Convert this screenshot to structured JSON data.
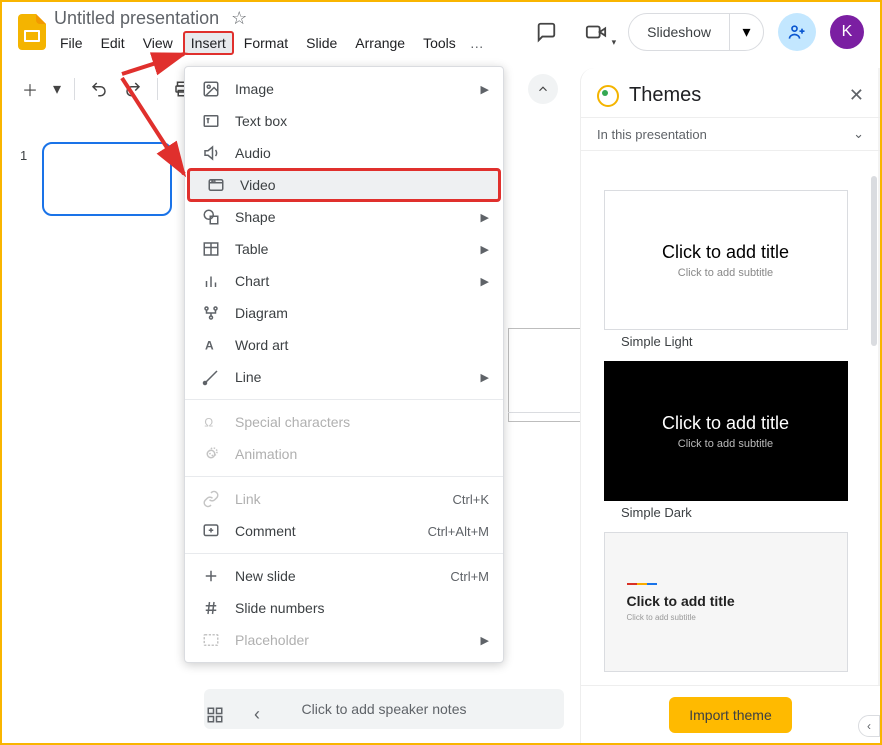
{
  "doc": {
    "title": "Untitled presentation"
  },
  "menubar": {
    "items": [
      "File",
      "Edit",
      "View",
      "Insert",
      "Format",
      "Slide",
      "Arrange",
      "Tools"
    ],
    "active_index": 3,
    "more": "…"
  },
  "header": {
    "slideshow": "Slideshow",
    "avatar_letter": "K"
  },
  "filmstrip": {
    "slide_number": "1"
  },
  "insert_menu": {
    "items": [
      {
        "label": "Image",
        "icon": "image-icon",
        "submenu": true
      },
      {
        "label": "Text box",
        "icon": "textbox-icon"
      },
      {
        "label": "Audio",
        "icon": "audio-icon"
      },
      {
        "label": "Video",
        "icon": "video-icon",
        "highlight": true,
        "boxed": true
      },
      {
        "label": "Shape",
        "icon": "shape-icon",
        "submenu": true
      },
      {
        "label": "Table",
        "icon": "table-icon",
        "submenu": true
      },
      {
        "label": "Chart",
        "icon": "chart-icon",
        "submenu": true
      },
      {
        "label": "Diagram",
        "icon": "diagram-icon"
      },
      {
        "label": "Word art",
        "icon": "wordart-icon"
      },
      {
        "label": "Line",
        "icon": "line-icon",
        "submenu": true
      }
    ],
    "items2": [
      {
        "label": "Special characters",
        "icon": "omega-icon",
        "disabled": true
      },
      {
        "label": "Animation",
        "icon": "animation-icon",
        "disabled": true
      }
    ],
    "items3": [
      {
        "label": "Link",
        "icon": "link-icon",
        "disabled": true,
        "shortcut": "Ctrl+K"
      },
      {
        "label": "Comment",
        "icon": "comment-add-icon",
        "shortcut": "Ctrl+Alt+M"
      }
    ],
    "items4": [
      {
        "label": "New slide",
        "icon": "plus-icon",
        "shortcut": "Ctrl+M"
      },
      {
        "label": "Slide numbers",
        "icon": "hash-icon"
      },
      {
        "label": "Placeholder",
        "icon": "placeholder-icon",
        "disabled": true,
        "submenu": true
      }
    ]
  },
  "themes": {
    "title": "Themes",
    "subtitle": "In this presentation",
    "cards": [
      {
        "name": "Simple Light",
        "title": "Click to add title",
        "sub": "Click to add subtitle",
        "variant": "light"
      },
      {
        "name": "Simple Dark",
        "title": "Click to add title",
        "sub": "Click to add subtitle",
        "variant": "dark"
      },
      {
        "name": "",
        "title": "Click to add title",
        "sub": "Click to add subtitle",
        "variant": "accent"
      }
    ],
    "import": "Import theme"
  },
  "speaker_notes": "Click to add speaker notes"
}
